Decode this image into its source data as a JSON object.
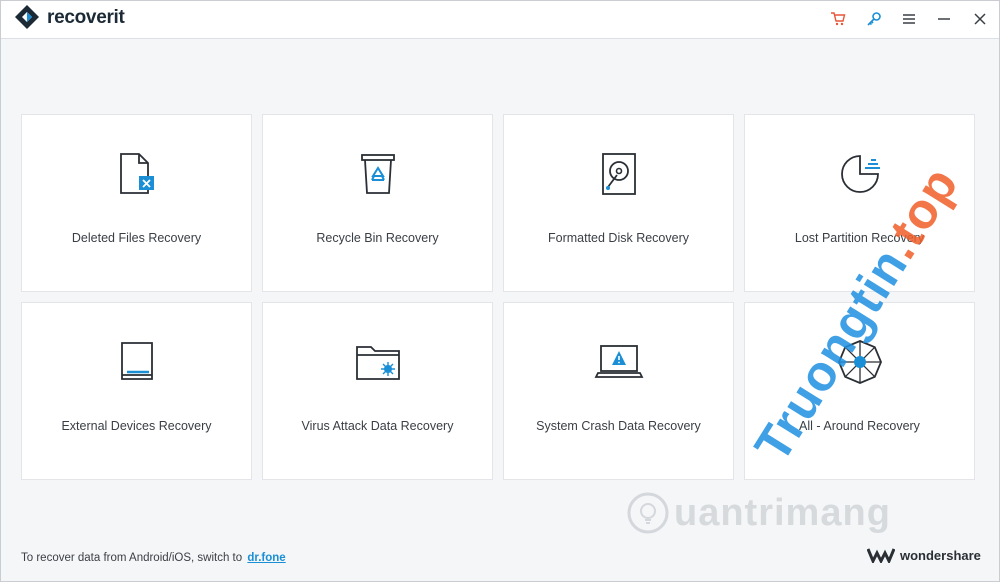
{
  "app": {
    "name": "recoverit"
  },
  "titlebar": {
    "icons": [
      "cart-icon",
      "key-icon",
      "menu-icon",
      "minimize-icon",
      "close-icon"
    ],
    "cart_color": "#e8553a",
    "key_color": "#1a8fd6"
  },
  "cards": [
    {
      "label": "Deleted Files Recovery",
      "icon": "deleted-file-icon"
    },
    {
      "label": "Recycle Bin Recovery",
      "icon": "recycle-bin-icon"
    },
    {
      "label": "Formatted Disk Recovery",
      "icon": "hard-disk-icon"
    },
    {
      "label": "Lost Partition Recovery",
      "icon": "pie-partition-icon"
    },
    {
      "label": "External Devices Recovery",
      "icon": "external-drive-icon"
    },
    {
      "label": "Virus Attack Data Recovery",
      "icon": "virus-folder-icon"
    },
    {
      "label": "System Crash Data Recovery",
      "icon": "crashed-laptop-icon"
    },
    {
      "label": "All - Around Recovery",
      "icon": "all-around-icon"
    }
  ],
  "footer": {
    "text": "To recover data from Android/iOS, switch to",
    "link": "dr.fone",
    "brand": "wondershare"
  },
  "watermarks": {
    "domain": "Truongtin",
    "tld": ".top",
    "secondary": "uantrimang"
  },
  "colors": {
    "accent": "#1a8fd6",
    "icon_stroke": "#2a2f35"
  }
}
